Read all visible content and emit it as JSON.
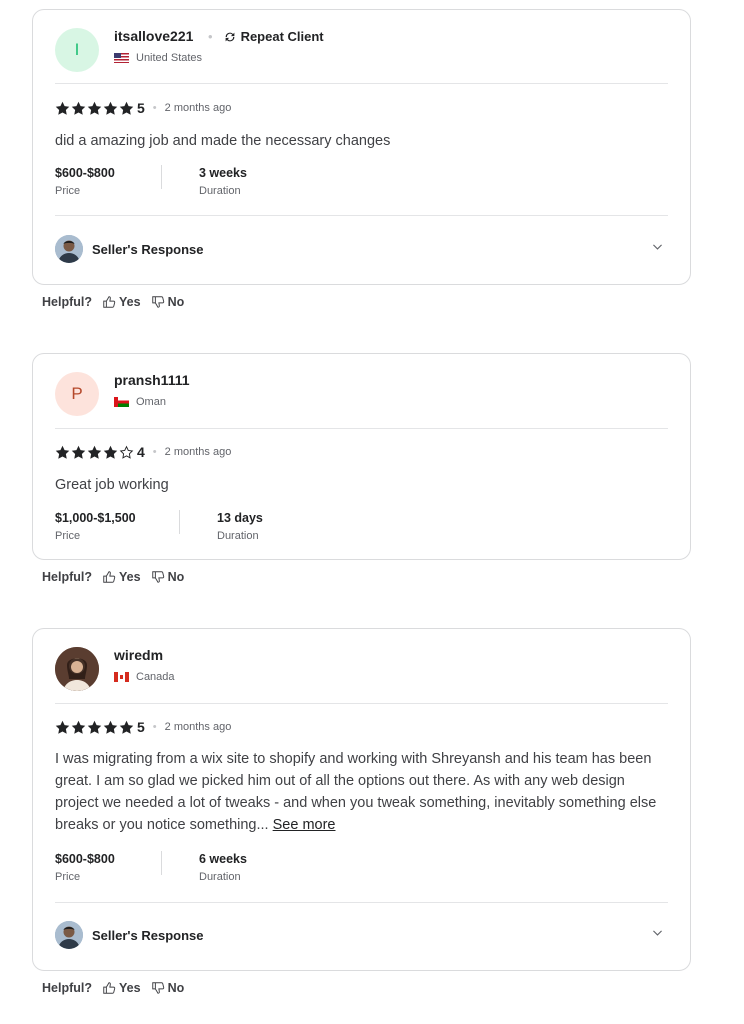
{
  "reviews": [
    {
      "username": "itsallove221",
      "avatar_letter": "I",
      "avatar_bg": "#d8f6e4",
      "avatar_color": "#1dbf73",
      "repeat_label": "Repeat Client",
      "country": "United States",
      "flag": "us-flag",
      "rating": "5",
      "stars_filled": 5,
      "time_ago": "2 months ago",
      "text": "did a amazing job and made the necessary changes",
      "price": "$600-$800",
      "price_label": "Price",
      "duration": "3 weeks",
      "duration_label": "Duration",
      "seller_response_label": "Seller's Response"
    },
    {
      "username": "pransh1111",
      "avatar_letter": "P",
      "avatar_bg": "#fde3dc",
      "avatar_color": "#b5482a",
      "country": "Oman",
      "flag": "om-flag",
      "rating": "4",
      "stars_filled": 4,
      "time_ago": "2 months ago",
      "text": "Great job working",
      "price": "$1,000-$1,500",
      "price_label": "Price",
      "duration": "13 days",
      "duration_label": "Duration"
    },
    {
      "username": "wiredm",
      "avatar_photo": "user-photo",
      "country": "Canada",
      "flag": "ca-flag",
      "rating": "5",
      "stars_filled": 5,
      "time_ago": "2 months ago",
      "text": "I was migrating from a wix site to shopify and working with Shreyansh and his team has been great. I am so glad we picked him out of all the options out there. As with any web design project we needed a lot of tweaks - and when you tweak something, inevitably something else breaks or you notice something...",
      "see_more": "See more",
      "price": "$600-$800",
      "price_label": "Price",
      "duration": "6 weeks",
      "duration_label": "Duration",
      "seller_response_label": "Seller's Response"
    }
  ],
  "helpful": {
    "question": "Helpful?",
    "yes": "Yes",
    "no": "No"
  },
  "colors": {
    "star": "#222325",
    "text": "#404145",
    "muted": "#62646a",
    "border": "#dadbdd"
  }
}
